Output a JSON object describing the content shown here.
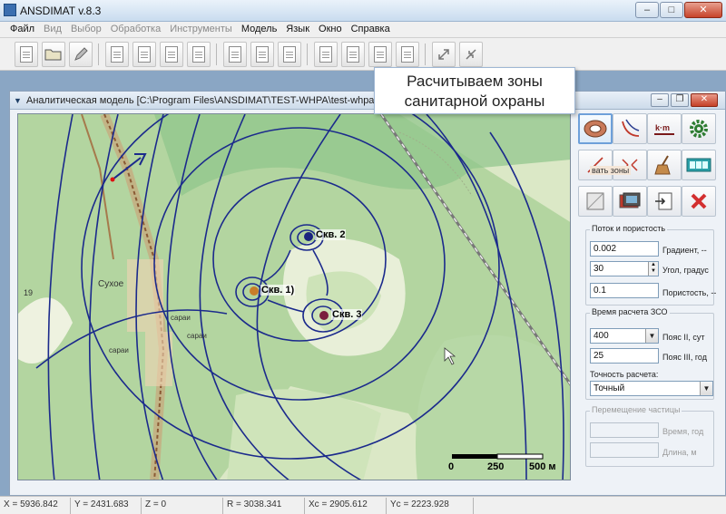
{
  "app": {
    "title": "ANSDIMAT v.8.3"
  },
  "window_buttons": {
    "minimize": "–",
    "maximize": "□",
    "close": "✕"
  },
  "menu": [
    {
      "label": "Файл",
      "enabled": true
    },
    {
      "label": "Вид",
      "enabled": false
    },
    {
      "label": "Выбор",
      "enabled": false
    },
    {
      "label": "Обработка",
      "enabled": false
    },
    {
      "label": "Инструменты",
      "enabled": false
    },
    {
      "label": "Модель",
      "enabled": true
    },
    {
      "label": "Язык",
      "enabled": true
    },
    {
      "label": "Окно",
      "enabled": true
    },
    {
      "label": "Справка",
      "enabled": true
    }
  ],
  "child_window": {
    "title": "Аналитическая модель  [C:\\Program Files\\ANSDIMAT\\TEST-WHPA\\test-whpa.atm]",
    "buttons": {
      "minimize": "–",
      "restore": "❐",
      "close": "✕"
    }
  },
  "map": {
    "wells": [
      {
        "label": "Скв. 1)",
        "color": "#c87d2a"
      },
      {
        "label": "Скв. 2",
        "color": "#1a237e"
      },
      {
        "label": "Скв. 3",
        "color": "#7a1f3d"
      }
    ],
    "place_labels": [
      "Сухое",
      "сараи",
      "сараи",
      "сараи",
      "19"
    ],
    "scale_bar": {
      "labels": [
        "0",
        "250",
        "500 м"
      ]
    },
    "contour_color": "#1b2a8c"
  },
  "tooltip": {
    "line1": "Расчитываем зоны",
    "line2": "санитарной охраны"
  },
  "tools": {
    "zone_label": "вать зоны",
    "icons": [
      "well-model-icon",
      "streamline-icon",
      "km-icon",
      "settings-gear-icon",
      "particle-track-icon",
      "calc-zones-icon",
      "broom-icon",
      "film-icon",
      "grid-icon",
      "image-icon",
      "export-icon",
      "delete-icon"
    ]
  },
  "flow_group": {
    "legend": "Поток и пористость",
    "gradient": {
      "value": "0.002",
      "label": "Градиент, --"
    },
    "angle": {
      "value": "30",
      "label": "Угол, градус"
    },
    "porosity": {
      "value": "0.1",
      "label": "Пористость, --"
    }
  },
  "zso_group": {
    "legend": "Время расчета ЗСО",
    "belt2": {
      "value": "400",
      "label": "Пояс II, сут"
    },
    "belt3": {
      "value": "25",
      "label": "Пояс III, год"
    },
    "precision_label": "Точность расчета:",
    "precision_value": "Точный"
  },
  "particle_group": {
    "legend": "Перемещение частицы",
    "time_label": "Время, год",
    "length_label": "Длина, м"
  },
  "status": [
    "X = 5936.842",
    "Y = 2431.683",
    "Z = 0",
    "R = 3038.341",
    "Xc = 2905.612",
    "Yc = 2223.928"
  ]
}
